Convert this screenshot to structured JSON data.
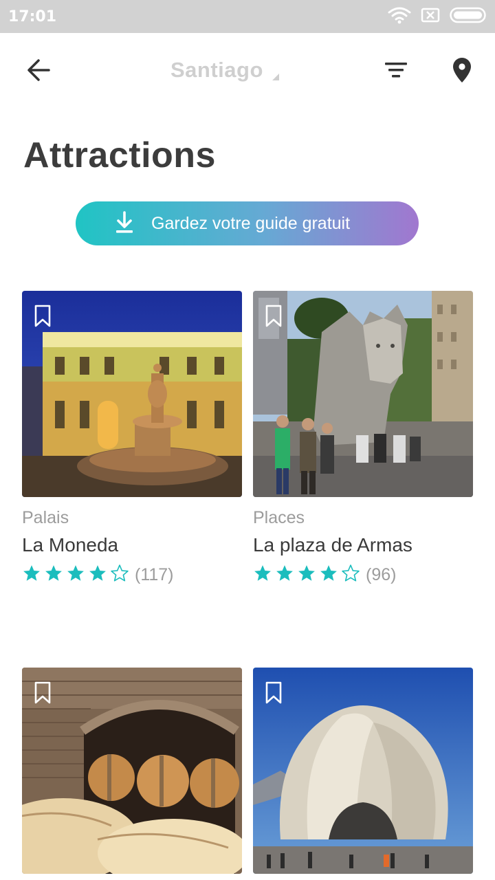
{
  "status_bar": {
    "time": "17:01"
  },
  "header": {
    "title": "Santiago"
  },
  "page": {
    "title": "Attractions"
  },
  "guide_button": {
    "label": "Gardez votre guide gratuit"
  },
  "cards": [
    {
      "category": "Palais",
      "name": "La Moneda",
      "rating": 4,
      "max_rating": 5,
      "reviews": "(117)"
    },
    {
      "category": "Places",
      "name": "La plaza de Armas",
      "rating": 4,
      "max_rating": 5,
      "reviews": "(96)"
    },
    {
      "category": "",
      "name": "",
      "rating": 0,
      "max_rating": 5,
      "reviews": ""
    },
    {
      "category": "",
      "name": "",
      "rating": 0,
      "max_rating": 5,
      "reviews": ""
    }
  ],
  "colors": {
    "accent": "#1bbdbd",
    "gradient_start": "#20c4c4",
    "gradient_end": "#a177cf",
    "status_bar": "#d2d2d2",
    "title_muted": "#cfcfcf"
  },
  "icons": {
    "back": "arrow-left-icon",
    "filter": "filter-icon",
    "map": "map-pin-icon",
    "download": "download-icon",
    "bookmark": "bookmark-icon",
    "star": "star-icon"
  }
}
